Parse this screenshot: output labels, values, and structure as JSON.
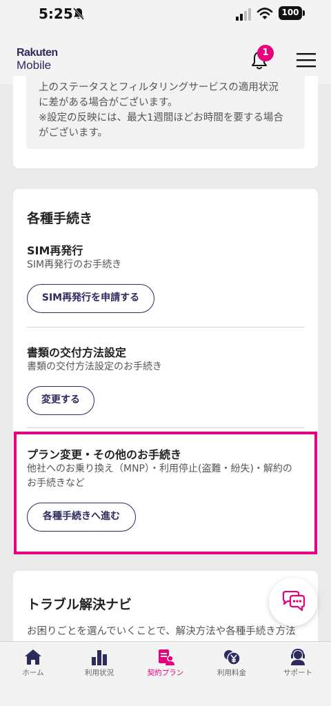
{
  "status_bar": {
    "time": "5:25",
    "battery": "100"
  },
  "header": {
    "logo_line1": "Rakuten",
    "logo_line2": "Mobile",
    "notification_count": "1"
  },
  "notice": {
    "lines": [
      "上のステータスとフィルタリングサービスの適用状況",
      "に差がある場合がございます。",
      "※設定の反映には、最大1週間ほどお時間を要する場合",
      "がございます。"
    ]
  },
  "procedures": {
    "title": "各種手続き",
    "sim": {
      "title": "SIM再発行",
      "desc": "SIM再発行のお手続き",
      "button": "SIM再発行を申請する"
    },
    "docs": {
      "title": "書類の交付方法設定",
      "desc": "書類の交付方法設定のお手続き",
      "button": "変更する"
    },
    "plan": {
      "title": "プラン変更・その他のお手続き",
      "desc_line1": "他社へのお乗り換え（MNP）・利用停止(盗難・紛失)・解約の",
      "desc_line2": "お手続きなど",
      "button": "各種手続きへ進む"
    }
  },
  "trouble": {
    "title": "トラブル解決ナビ",
    "desc": "お困りごとを選んでいくことで、解決方法や各種手続き方法"
  },
  "tabs": [
    {
      "label": "ホーム",
      "icon": "home-icon"
    },
    {
      "label": "利用状況",
      "icon": "bar-chart-icon"
    },
    {
      "label": "契約プラン",
      "icon": "contract-icon"
    },
    {
      "label": "利用料金",
      "icon": "yen-coin-icon"
    },
    {
      "label": "サポート",
      "icon": "support-icon"
    }
  ],
  "colors": {
    "accent": "#e6007e",
    "navy": "#2d2a5e"
  }
}
